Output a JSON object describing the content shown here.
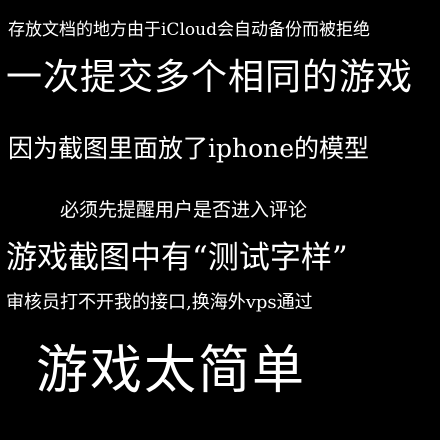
{
  "lines": [
    "存放文档的地方由于iCloud会自动备份而被拒绝",
    "一次提交多个相同的游戏",
    "因为截图里面放了iphone的模型",
    "必须先提醒用户是否进入评论",
    "游戏截图中有“测试字样”",
    "审核员打不开我的接口,换海外vps通过",
    "游戏太简单"
  ],
  "colors": {
    "background": "#000000",
    "text": "#ffffff"
  }
}
